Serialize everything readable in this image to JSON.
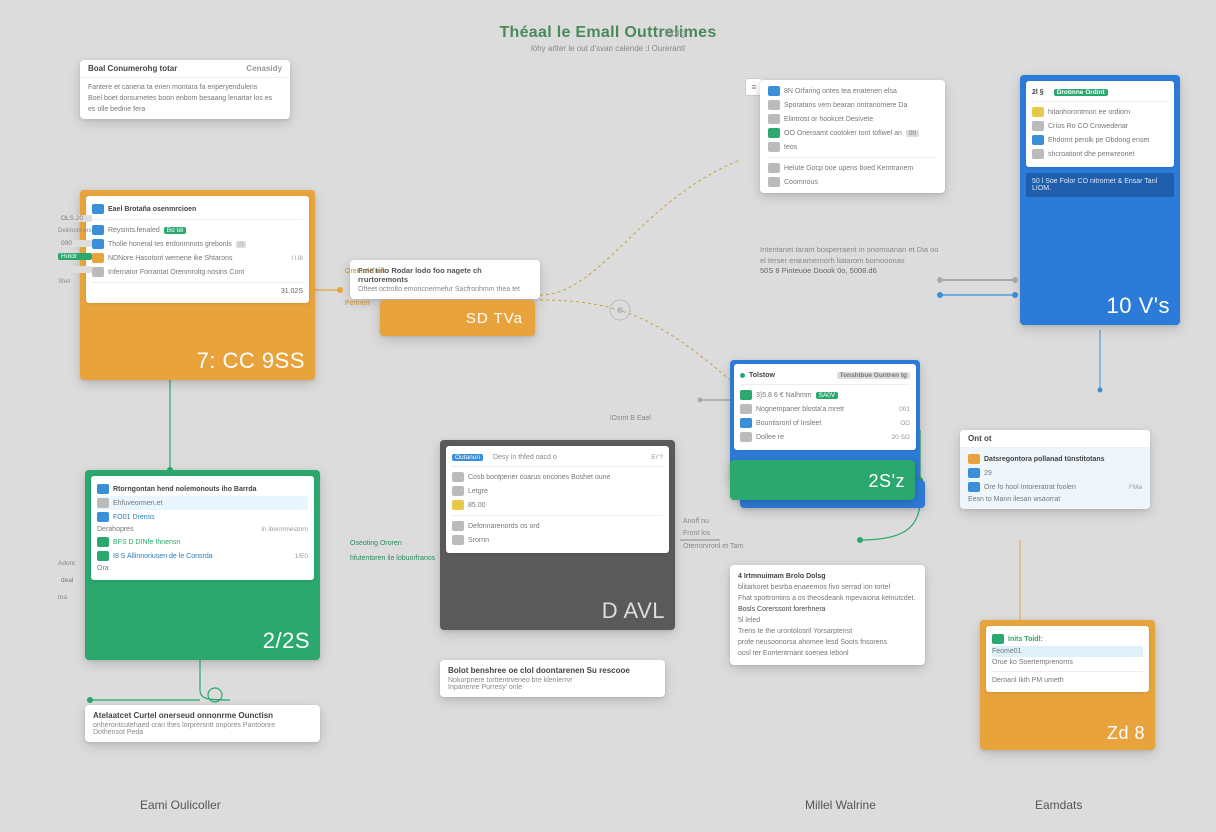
{
  "title": "Théaal le Emall Outtrelimes",
  "subtitle": "löhy arlter le out  d'svan calende :l Ourerantl",
  "tag": "Dorg",
  "footer": {
    "left": "Eami Oulicoller",
    "mid": "Millel Walrine",
    "right": "Eamdats"
  },
  "cards": {
    "top_left_box": {
      "h1": "Boal  Conumerohg totar",
      "h2": "Cenasidy",
      "lines": [
        "Fantere et canena ta enen montara fa enperyendulens",
        "Boel boet dorsurnetes boon enbom  besaang lenartar los es",
        "es olle bedine  fera"
      ]
    },
    "orange_main": {
      "h": "Eael  Brotaña osenmrcioen",
      "rows": [
        {
          "ico": "ico-b",
          "t": "Reysints.fenaled",
          "v": "Bd tél"
        },
        {
          "ico": "ico-b",
          "t": "Tholle honeral tes erdonrnnots grebonls",
          "v": ""
        },
        {
          "ico": "ico-o",
          "t": "NDNore Hasotont wemene ike  Shtarons",
          "v": "l l.l8"
        },
        {
          "ico": "ico-gr",
          "t": "Infernator Forrantat Orenmroltg nosins Cont",
          "v": ""
        }
      ],
      "left_tags": [
        "OLS.20",
        "Delimom ors",
        "000",
        "Hotdr",
        "",
        "Shel"
      ],
      "big": "7: CC  9SS",
      "small_val": "31.02S"
    },
    "orange_token": {
      "top": "Fme tiño Rodar lodo foo nagete ch rrurtoremonts",
      "sub": "Ofteet octrolto emoncnermefur Sacfronhmm thea tet",
      "val": "SD  TVa"
    },
    "col2_top": {
      "rows": [
        {
          "ico": "ico-b",
          "t": "8N Orfaring ontes tea enatenen elsa",
          "v": ""
        },
        {
          "ico": "ico-gr",
          "t": "Sporatans vem bearan ontranomere Da",
          "v": ""
        },
        {
          "ico": "ico-gr",
          "t": "Elintrost or hookcet Desivete",
          "v": ""
        },
        {
          "ico": "ico-g",
          "t": "OO  Oneroamt cootoker tont tofiwel an",
          "v": "00"
        },
        {
          "ico": "ico-gr",
          "t": "teos",
          "v": ""
        },
        {
          "ico": "ico-gr",
          "t": "Helute Gocp ooe upens boed  Kemtranem",
          "v": ""
        },
        {
          "ico": "ico-gr",
          "t": "Coomnous",
          "v": ""
        }
      ],
      "footer_lines": [
        "Intentanet tarant bosperraent in onomoanan et  Dia oo",
        "el terser eraramernorh liatarom bomooonas",
        "50S  8  Pinteuoe  Doook           0o,       5008.d6"
      ]
    },
    "blue_panel": {
      "h": "2l §",
      "rows": [
        {
          "ico": "ico-g",
          "t": "Drotmne Ordint",
          "v": ""
        },
        {
          "ico": "ico-y",
          "t": "hitanhorontmon ee ordiorn",
          "v": ""
        },
        {
          "ico": "ico-gr",
          "t": "Críos  Ro CO Crowedenar",
          "v": ""
        },
        {
          "ico": "ico-b",
          "t": "Ehdornt perolk pe Obdong enset",
          "v": ""
        },
        {
          "ico": "ico-gr",
          "t": "shcroationt dhe penwreonet",
          "v": ""
        }
      ],
      "strip": "50 l  Soe Folor CO nitrornet & Ensar Tanl  LIOM.",
      "big": "10  V's"
    },
    "blue_mid": {
      "h": "Tolstow",
      "rows": [
        {
          "ico": "ico-g",
          "t": "3)5.8 6 € Nalhmm",
          "v": "SA0V"
        },
        {
          "ico": "ico-gr",
          "t": "Nognempaner blosta'a mretr",
          "v": "001"
        },
        {
          "ico": "ico-b",
          "t": "Bountisronl of  Insleet",
          "v": "OD"
        },
        {
          "ico": "ico-gr",
          "t": "Dollee re",
          "v": "20  SO"
        }
      ],
      "tag": "Tonshibue Ountren tg"
    },
    "green_blue_stack": {
      "big": "2S'z"
    },
    "green_left": {
      "rows": [
        {
          "ico": "ico-b",
          "t": "Rtorngontan hend  nolemonouts iho Barrda",
          "v": ""
        },
        {
          "ico": "ico-gr",
          "t": "Ehfuveormen.et",
          "v": ""
        },
        {
          "ico": "ico-b",
          "t": "FO01  Drenss",
          "v": ""
        },
        {
          "ico": "ico-gr",
          "t": "Derahopres",
          "v": "ln ibermmestorn"
        },
        {
          "ico": "ico-g",
          "t": "BFS  D DINfe Ihnensn",
          "v": ""
        },
        {
          "ico": "ico-g",
          "t": "I8 S Allinnoriusen de le Consrda",
          "v": "1/E0"
        },
        {
          "ico": "ico-gr",
          "t": "Ora",
          "v": ""
        }
      ],
      "left_tags": [
        "Adont",
        "deal",
        "tna"
      ],
      "big": "2/2S"
    },
    "dark_mid": {
      "h": "Outanun",
      "rows": [
        {
          "ico": "ico-b",
          "t": "Desy in thfed oacd o",
          "v": "Er’?"
        },
        {
          "ico": "ico-gr",
          "t": "Cosb bontpener coarus oncones  Boshet oune",
          "v": ""
        },
        {
          "ico": "ico-gr",
          "t": "Letgre",
          "v": ""
        },
        {
          "ico": "ico-y",
          "t": "85.00",
          "v": ""
        },
        {
          "ico": "ico-gr",
          "t": "Defonnarenords os ord",
          "v": ""
        },
        {
          "ico": "ico-gr",
          "t": "Srornn",
          "v": ""
        }
      ],
      "big": "D  AVL"
    },
    "col3_text": {
      "rows": [
        "4   Irtmnuimam Brolo Dolsg",
        "   blitarkoret besrba enaeemos fivo serrad ion tortel",
        "   Fhat spottrontins a os theosdeank mpevaiona kelnutcdet.",
        "   Bosls Corerssont forerhnera",
        "   5l leled",
        "   Trens te the urontolosril Yorsarptenst",
        "   profe neusoonorsa ahomee lesd Soots fnsorens",
        "   oosl ter Eontentrnant  soenea lebonl"
      ]
    },
    "col3_small": {
      "h": "Ont ot",
      "rows": [
        {
          "ico": "ico-o",
          "t": "Datsregontora pollanad  tünstitotans",
          "v": ""
        },
        {
          "ico": "ico-b",
          "t": "29",
          "v": ""
        },
        {
          "ico": "ico-b",
          "t": "Ore fo hool  Intoreratrat foolen",
          "v": "FMa"
        },
        {
          "ico": "ico-gr",
          "t": "Eesn to Mann ilesan wsaorrat",
          "v": ""
        }
      ]
    },
    "orange_br": {
      "rows": [
        {
          "ico": "ico-g",
          "t": "Inits  Toidl:",
          "v": ""
        },
        {
          "ico": "ico-gr",
          "t": "Feome01",
          "v": ""
        },
        {
          "ico": "ico-gr",
          "t": "Orue ko Soertemprenorns",
          "v": ""
        },
        {
          "ico": "ico-gr",
          "t": "Deroanl Ikth PM umeth",
          "v": ""
        }
      ],
      "big": "Zd 8"
    },
    "note_bl": {
      "h": "Atelaatcet Curtel onerseud onnonrme Ounctisn",
      "l1": "onherontcutehaed cran thes lorprersntt onpores Pantoonre",
      "l2": "Dothensot Peda"
    },
    "note_mid": {
      "h": "Bolot benshree oe clol doontarenen  Su rescooe",
      "l1": "Nokorpnere torttentrveneo bre klenlerrvr",
      "l2": "Inpanenre  Purresy'  onle"
    },
    "labels": {
      "l1": "Orente'l Tosn",
      "l2": "Pertnerr",
      "l3": "Oseoting Ororen",
      "l4": "hfutentoren ile lobuorfranos",
      "l5": "Front los",
      "l6": "Oterrorvronl et Tarn",
      "l7": "lOsmt B Eael",
      "l8": "Anoff nu"
    }
  }
}
